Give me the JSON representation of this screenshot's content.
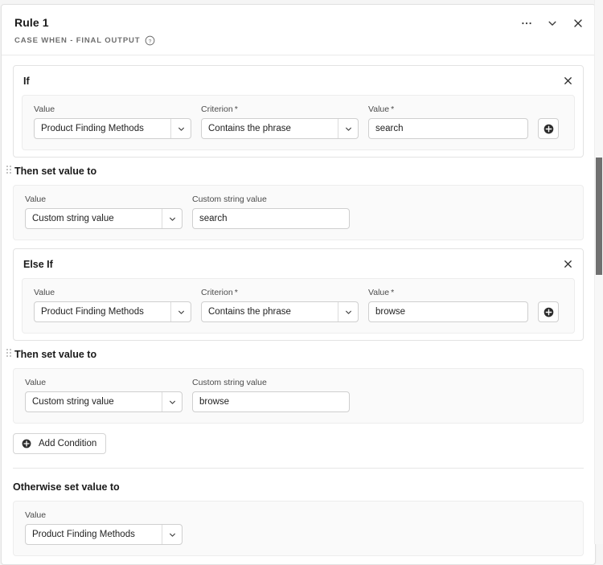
{
  "header": {
    "title": "Rule 1",
    "subtitle": "CASE WHEN - FINAL OUTPUT",
    "help_icon": "question-circle-icon",
    "actions": [
      {
        "name": "more-options",
        "icon": "ellipsis-icon",
        "label": "…"
      },
      {
        "name": "collapse",
        "icon": "chevron-down-icon",
        "label": "⌄"
      },
      {
        "name": "close",
        "icon": "close-icon",
        "label": "×"
      }
    ]
  },
  "labels": {
    "value": "Value",
    "criterion": "Criterion",
    "custom_string_value": "Custom string value",
    "required_marker": "*",
    "then_set_value_to": "Then set value to",
    "otherwise_set_value_to": "Otherwise set value to",
    "add_condition": "Add Condition",
    "add_row_icon": "plus-circle-icon",
    "remove_icon": "close-icon",
    "drag_icon": "drag-handle-icon",
    "dropdown_icon": "chevron-down-icon"
  },
  "conditions": [
    {
      "label": "If",
      "criteria_row": {
        "value_field": {
          "label": "Value",
          "selected": "Product Finding Methods",
          "required": false
        },
        "criterion_field": {
          "label": "Criterion",
          "selected": "Contains the phrase",
          "required": true
        },
        "compare_field": {
          "label": "Value",
          "value": "search",
          "required": true
        }
      },
      "then": {
        "title": "Then set value to",
        "value_field": {
          "label": "Value",
          "selected": "Custom string value"
        },
        "custom_field": {
          "label": "Custom string value",
          "value": "search"
        }
      }
    },
    {
      "label": "Else If",
      "criteria_row": {
        "value_field": {
          "label": "Value",
          "selected": "Product Finding Methods",
          "required": false
        },
        "criterion_field": {
          "label": "Criterion",
          "selected": "Contains the phrase",
          "required": true
        },
        "compare_field": {
          "label": "Value",
          "value": "browse",
          "required": true
        }
      },
      "then": {
        "title": "Then set value to",
        "value_field": {
          "label": "Value",
          "selected": "Custom string value"
        },
        "custom_field": {
          "label": "Custom string value",
          "value": "browse"
        }
      }
    }
  ],
  "otherwise": {
    "title": "Otherwise set value to",
    "value_field": {
      "label": "Value",
      "selected": "Product Finding Methods"
    }
  },
  "colors": {
    "page_background": "#f5f5f5",
    "card_background": "#ffffff",
    "panel_background": "#fafafa",
    "border": "#e1e1e1",
    "field_border": "#cfcfcf",
    "text_primary": "#1a1a1a",
    "text_secondary": "#6e6e6e",
    "scrollbar_thumb": "#707070"
  }
}
